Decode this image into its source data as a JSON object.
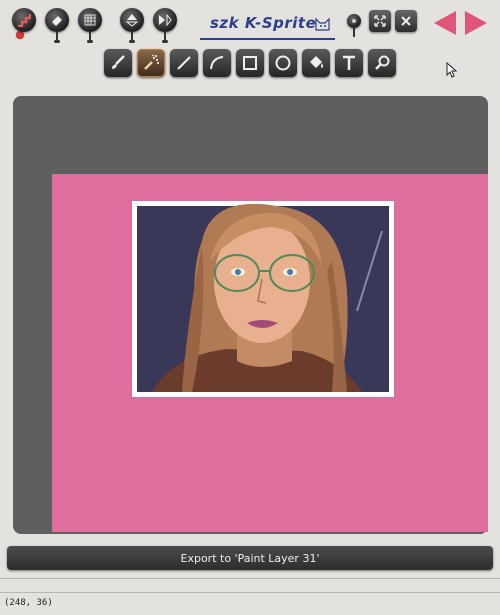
{
  "app": {
    "logo_text": "szk K-Sprite",
    "colors": {
      "canvas_bg": "#df6e9f",
      "workspace_bg": "#5f5f5f",
      "nav_arrow": "#e0557a",
      "logo": "#2d3e8a"
    }
  },
  "top_buttons": [
    {
      "name": "stairs-icon"
    },
    {
      "name": "eraser-icon"
    },
    {
      "name": "grid-icon"
    },
    {
      "name": "flip-vertical-icon"
    },
    {
      "name": "flip-horizontal-icon"
    }
  ],
  "window_controls": [
    {
      "name": "minimize-icon"
    },
    {
      "name": "maximize-icon"
    },
    {
      "name": "close-icon"
    }
  ],
  "tools": [
    {
      "name": "brush-tool",
      "icon": "brush-icon",
      "active": false
    },
    {
      "name": "spray-tool",
      "icon": "spray-icon",
      "active": true
    },
    {
      "name": "line-tool",
      "icon": "line-icon",
      "active": false
    },
    {
      "name": "curve-tool",
      "icon": "curve-icon",
      "active": false
    },
    {
      "name": "rectangle-tool",
      "icon": "rectangle-icon",
      "active": false
    },
    {
      "name": "ellipse-tool",
      "icon": "ellipse-icon",
      "active": false
    },
    {
      "name": "fill-tool",
      "icon": "paint-bucket-icon",
      "active": false
    },
    {
      "name": "text-tool",
      "icon": "text-icon",
      "active": false
    },
    {
      "name": "zoom-tool",
      "icon": "magnifier-icon",
      "active": false
    }
  ],
  "nav": {
    "prev": "previous-arrow-icon",
    "next": "next-arrow-icon"
  },
  "export_label": "Export to 'Paint Layer 31'",
  "status": {
    "coords": "(248, 36)"
  }
}
